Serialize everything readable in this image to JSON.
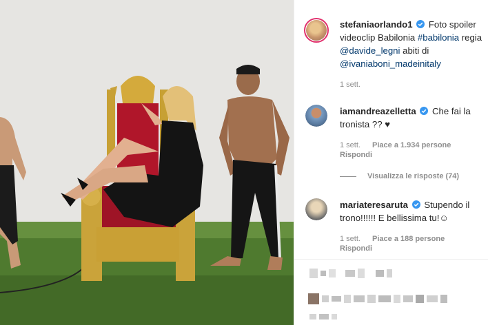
{
  "post": {
    "author": "stefaniaorlando1",
    "caption_text_1": "Foto spoiler videoclip Babilonia",
    "caption_hashtag": "#babilonia",
    "caption_text_2": "regia",
    "caption_mention_1": "@davide_legni",
    "caption_text_3": "abiti di",
    "caption_mention_2": "@ivaniaboni_madeinitaly",
    "time": "1 sett."
  },
  "comments": [
    {
      "username": "iamandreazelletta",
      "text": "Che fai la tronista ?? ♥",
      "time": "1 sett.",
      "likes": "Piace a 1.934 persone",
      "reply": "Rispondi",
      "view_replies": "Visualizza le risposte (74)"
    },
    {
      "username": "mariateresaruta",
      "text": "Stupendo il trono!!!!!! E bellissima tu!☺",
      "time": "1 sett.",
      "likes": "Piace a 188 persone",
      "reply": "Rispondi"
    }
  ],
  "colors": {
    "verified": "#3897f0",
    "link": "#00376b",
    "meta": "#8e8e8e",
    "story_ring": "#e1306c"
  },
  "icons": {
    "verified": "verified-badge-icon"
  }
}
